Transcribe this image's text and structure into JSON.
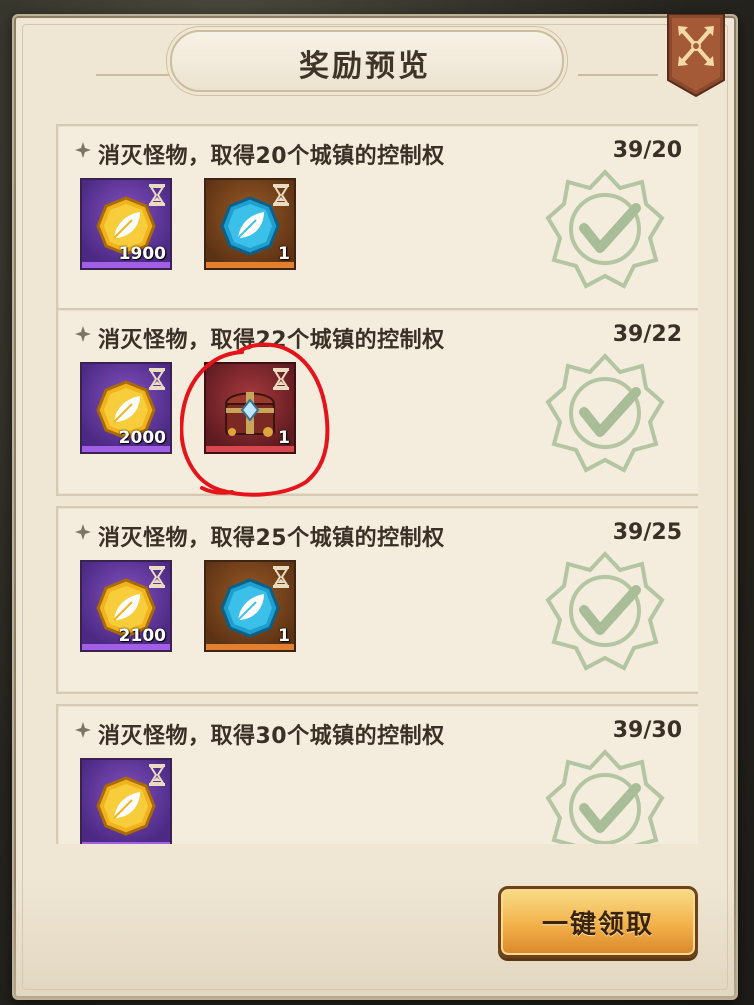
{
  "title": "奖励预览",
  "claim_button": "一键领取",
  "tasks": [
    {
      "title": "消灭怪物，取得20个城镇的控制权",
      "progress": "39/20",
      "rewards": [
        {
          "icon": "gold-leaf-coin-icon",
          "frame": "purple",
          "qty": "1900"
        },
        {
          "icon": "blue-leaf-gem-icon",
          "frame": "orange",
          "qty": "1"
        }
      ]
    },
    {
      "title": "消灭怪物，取得22个城镇的控制权",
      "progress": "39/22",
      "rewards": [
        {
          "icon": "gold-leaf-coin-icon",
          "frame": "purple",
          "qty": "2000"
        },
        {
          "icon": "treasure-chest-icon",
          "frame": "red",
          "qty": "1"
        }
      ]
    },
    {
      "title": "消灭怪物，取得25个城镇的控制权",
      "progress": "39/25",
      "rewards": [
        {
          "icon": "gold-leaf-coin-icon",
          "frame": "purple",
          "qty": "2100"
        },
        {
          "icon": "blue-leaf-gem-icon",
          "frame": "orange",
          "qty": "1"
        }
      ]
    },
    {
      "title": "消灭怪物，取得30个城镇的控制权",
      "progress": "39/30",
      "rewards": [
        {
          "icon": "gold-leaf-coin-icon",
          "frame": "purple",
          "qty": ""
        }
      ]
    }
  ],
  "colors": {
    "panel": "#efe6d4",
    "stamp": "#7fa774",
    "annotation": "#e5141b",
    "button": "#f2b14a"
  }
}
